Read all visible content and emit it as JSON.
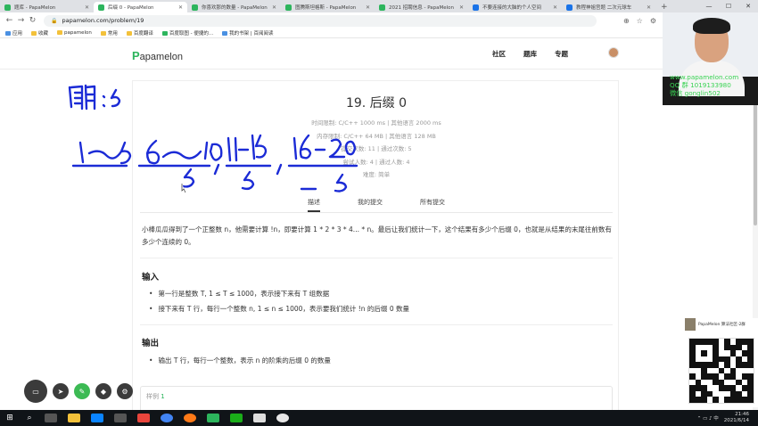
{
  "browser": {
    "tabs": [
      {
        "title": "题库 - PapaMelon",
        "active": false
      },
      {
        "title": "后缀 0 - PapaMelon",
        "active": true
      },
      {
        "title": "你喜欢那的数量 - PapaMelon",
        "active": false
      },
      {
        "title": "图腾斯坦格斯 - PapaMelon",
        "active": false
      },
      {
        "title": "2021 招聘信息 - PapaMelon",
        "active": false
      },
      {
        "title": "不要连接的大脑的个人空间",
        "active": false
      },
      {
        "title": "教程神姐宫题 二次元球车",
        "active": false
      }
    ],
    "new_tab": "+",
    "url": "papamelon.com/problem/19",
    "bookmarks": [
      "应用",
      "收藏",
      "papamelon",
      "常用",
      "百度翻译",
      "百度取图 - 便捷的...",
      "我的书架 | 百阅阅读"
    ]
  },
  "site": {
    "logo_rest": "apamelon",
    "logo_p": "P",
    "nav": [
      "社区",
      "题库",
      "专题"
    ]
  },
  "problem": {
    "title": "19. 后缀 0",
    "meta": [
      "时间限制: C/C++ 1000 ms | 其他语言 2000 ms",
      "内存限制: C/C++ 64 MB | 其他语言 128 MB",
      "提交次数: 11 | 通过次数: 5",
      "尝试人数: 4 | 通过人数: 4",
      "难度: 简单"
    ],
    "tabs": [
      "描述",
      "我的提交",
      "所有提交"
    ],
    "description": "小棒瓜瓜得到了一个正整数 n，他需要计算 !n，即要计算 1 * 2 * 3 * 4... * n。最后让我们统计一下，这个结果有多少个后缀 0，也就是从结果的末尾往前数有多少个连续的 0。",
    "input_heading": "输入",
    "input_items": [
      "第一行是整数 T, 1 ≤ T ≤ 1000，表示接下来有 T 组数据",
      "接下来有 T 行，每行一个整数 n, 1 ≤ n ≤ 1000，表示要我们统计 !n 的后缀 0 数量"
    ],
    "output_heading": "输出",
    "output_items": [
      "输出 T 行，每行一个整数，表示 n 的阶乘的后缀 0 的数量"
    ],
    "sample_label": "样例",
    "sample_num": "1"
  },
  "handwriting": {
    "line1": "周期:5",
    "line2": "1~5, 6~10, 11~15, 16~20",
    "under": [
      "5",
      "5",
      "5"
    ]
  },
  "overlay": {
    "cam_lines": [
      "www.papamelon.com",
      "QQ 群 1019133980",
      "微信 gonglin502"
    ],
    "qr_caption": "PapaMelon 算法社区-2群"
  },
  "taskbar": {
    "time": "21:46",
    "date": "2021/6/14"
  }
}
